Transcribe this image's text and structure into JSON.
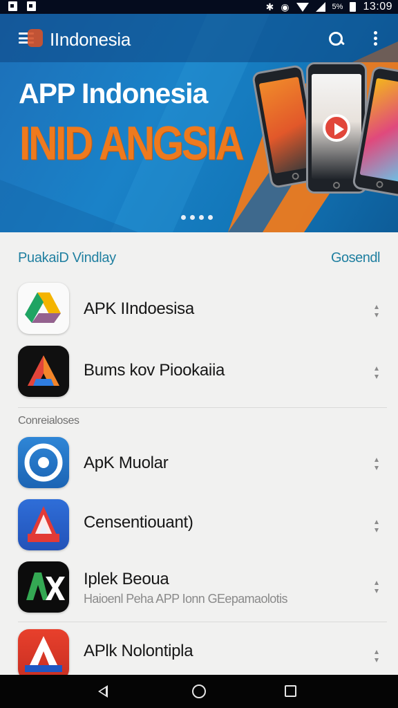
{
  "status_bar": {
    "left_icons": [
      "image-icon",
      "photo-icon"
    ],
    "right_icons": [
      "bluetooth-icon",
      "alarm-icon",
      "wifi-icon",
      "signal-icon",
      "battery-icon"
    ],
    "battery_text": "5%",
    "time": "13:09"
  },
  "app_bar": {
    "title": "IIndonesia",
    "icons": [
      "menu-icon",
      "app-logo-icon",
      "search-icon",
      "overflow-menu-icon"
    ]
  },
  "banner": {
    "title": "APP Indonesia",
    "subtitle": "INID ANGSIA",
    "subtitle_color": "#ee7a1e",
    "page_indicator": {
      "count": 4
    }
  },
  "section_featured": {
    "title": "PuakaiD Vindlay",
    "action": "Gosendl"
  },
  "featured_apps": [
    {
      "name": "APK IIndoesisa",
      "icon": "google-drive-style-icon",
      "more_icon": "more-options-icon"
    },
    {
      "name": "Bums kov Piookaiia",
      "icon": "triangle-a-dark-icon",
      "more_icon": "more-options-icon"
    }
  ],
  "section_more": {
    "label": "Conreialoses"
  },
  "more_apps": [
    {
      "name": "ApK Muolar",
      "icon": "target-ring-icon",
      "more_icon": "more-options-icon"
    },
    {
      "name": "Censentiouant)",
      "icon": "alicia-a-icon",
      "more_icon": "more-options-icon"
    },
    {
      "name": "Iplek Beoua",
      "description": "Haioenl Peha APP Ionn GEepamaolotis",
      "icon": "ax-logo-icon",
      "more_icon": "more-options-icon"
    },
    {
      "name": "APlk Nolontipla",
      "icon": "red-a-icon",
      "more_icon": "more-options-icon"
    }
  ],
  "nav_bar": {
    "icons": [
      "back-icon",
      "home-icon",
      "recents-icon"
    ]
  },
  "colors": {
    "banner_blue": "#1a82c8",
    "accent_orange": "#ee7a1e",
    "section_teal": "#1f7fa0"
  }
}
